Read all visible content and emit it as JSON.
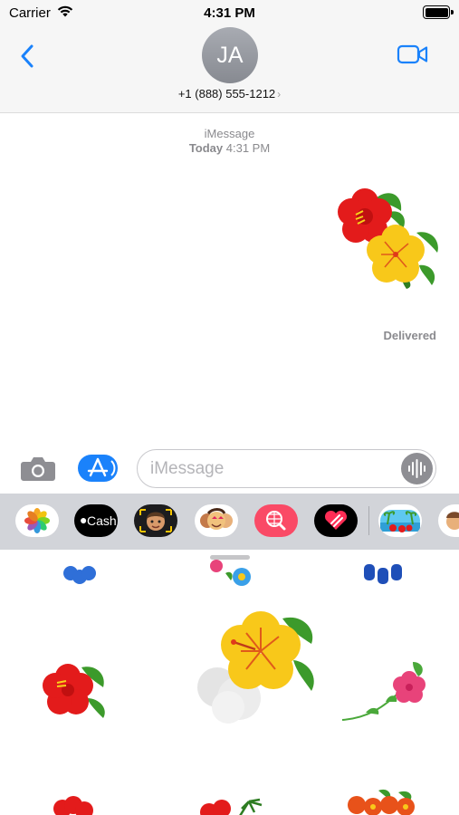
{
  "status_bar": {
    "carrier": "Carrier",
    "time": "4:31 PM"
  },
  "header": {
    "avatar_initials": "JA",
    "contact": "+1 (888) 555-1212",
    "contact_chevron": "›",
    "back_icon": "chevron-left-icon",
    "video_icon": "video-camera-icon"
  },
  "conversation": {
    "service": "iMessage",
    "date": "Today",
    "time": "4:31 PM",
    "status": "Delivered"
  },
  "input": {
    "placeholder": "iMessage",
    "value": ""
  },
  "app_drawer": {
    "items": [
      {
        "name": "photos",
        "icon": "photos-icon"
      },
      {
        "name": "apple-cash",
        "label": "Cash",
        "icon": "apple-cash-icon"
      },
      {
        "name": "memoji",
        "icon": "memoji-icon"
      },
      {
        "name": "memoji-stickers",
        "icon": "memoji-stickers-icon"
      },
      {
        "name": "image-search",
        "icon": "globe-search-icon"
      },
      {
        "name": "digital-touch",
        "icon": "heart-icon"
      },
      {
        "name": "hibiscus-stickers",
        "icon": "beach-icon"
      },
      {
        "name": "more-apps",
        "icon": "memoji-face-icon"
      }
    ]
  },
  "colors": {
    "accent": "#1a82fb",
    "header_bg": "#f6f6f6",
    "drawer_bg": "#d2d4d9",
    "hibiscus_red": "#e31b1b",
    "hibiscus_yellow": "#f8c81a",
    "leaf_green": "#3c9a2b",
    "flower_blue": "#2f6fd8"
  }
}
